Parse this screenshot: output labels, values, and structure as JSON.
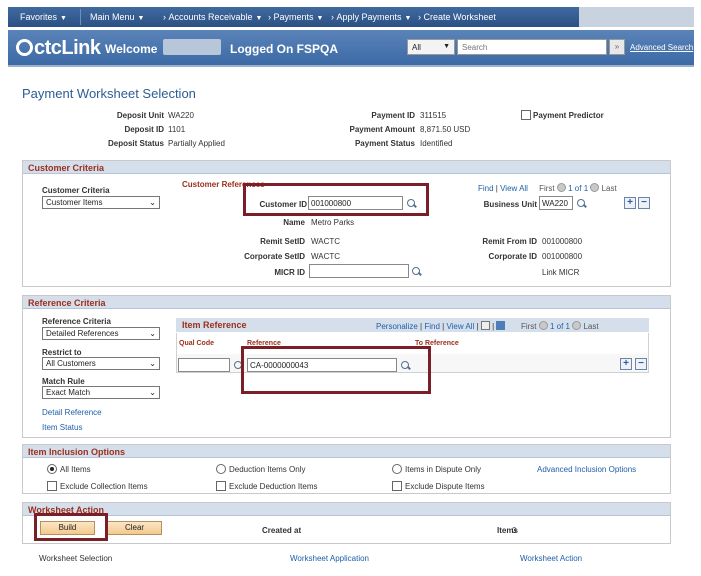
{
  "topnav": {
    "favorites": "Favorites",
    "main_menu": "Main Menu",
    "breadcrumb_accounts_receivable": "Accounts Receivable",
    "breadcrumb_payments": "Payments",
    "breadcrumb_apply_payments": "Apply Payments",
    "breadcrumb_create_worksheet": "Create Worksheet"
  },
  "banner": {
    "logo_text": "ctcLink",
    "welcome": "Welcome",
    "logged_on": "Logged On FSPQA",
    "search_scope": "All",
    "search_placeholder": "Search",
    "advanced_search": "Advanced Search"
  },
  "page_title": "Payment Worksheet Selection",
  "header": {
    "deposit_unit_label": "Deposit Unit",
    "deposit_unit_value": "WA220",
    "deposit_id_label": "Deposit ID",
    "deposit_id_value": "1101",
    "deposit_status_label": "Deposit Status",
    "deposit_status_value": "Partially Applied",
    "payment_id_label": "Payment ID",
    "payment_id_value": "311515",
    "payment_amount_label": "Payment Amount",
    "payment_amount_value": "8,871.50",
    "payment_currency": "USD",
    "payment_status_label": "Payment Status",
    "payment_status_value": "Identified",
    "payment_predictor_label": "Payment Predictor"
  },
  "customer_criteria": {
    "section_title": "Customer Criteria",
    "criteria_label": "Customer Criteria",
    "criteria_value": "Customer Items",
    "references_title": "Customer References",
    "find": "Find",
    "view_all": "View All",
    "first": "First",
    "pager": "1 of 1",
    "last": "Last",
    "customer_id_label": "Customer ID",
    "customer_id_value": "001000800",
    "business_unit_label": "Business Unit",
    "business_unit_value": "WA220",
    "name_label": "Name",
    "name_value": "Metro Parks",
    "remit_setid_label": "Remit SetID",
    "remit_setid_value": "WACTC",
    "remit_from_id_label": "Remit From ID",
    "remit_from_id_value": "001000800",
    "corporate_setid_label": "Corporate SetID",
    "corporate_setid_value": "WACTC",
    "corporate_id_label": "Corporate ID",
    "corporate_id_value": "001000800",
    "micr_id_label": "MICR ID",
    "link_micr": "Link MICR"
  },
  "reference_criteria": {
    "section_title": "Reference Criteria",
    "reference_criteria_label": "Reference Criteria",
    "reference_criteria_value": "Detailed References",
    "restrict_to_label": "Restrict to",
    "restrict_to_value": "All Customers",
    "match_rule_label": "Match Rule",
    "match_rule_value": "Exact Match",
    "detail_reference_link": "Detail Reference",
    "item_status_link": "Item Status",
    "grid_title": "Item Reference",
    "personalize": "Personalize",
    "find": "Find",
    "view_all": "View All",
    "first": "First",
    "pager": "1 of 1",
    "last": "Last",
    "col_qual_code": "Qual Code",
    "col_reference": "Reference",
    "col_to_reference": "To Reference",
    "reference_value": "CA-0000000043"
  },
  "inclusion": {
    "section_title": "Item Inclusion Options",
    "all_items": "All Items",
    "deduction_items_only": "Deduction Items Only",
    "items_in_dispute_only": "Items in Dispute Only",
    "advanced_inclusion_options": "Advanced Inclusion Options",
    "exclude_collection_items": "Exclude Collection Items",
    "exclude_deduction_items": "Exclude Deduction Items",
    "exclude_dispute_items": "Exclude Dispute Items"
  },
  "worksheet_action": {
    "section_title": "Worksheet Action",
    "build": "Build",
    "clear": "Clear",
    "created_at_label": "Created at",
    "items_label": "Items",
    "items_value": "0"
  },
  "footer_tabs": {
    "worksheet_selection": "Worksheet Selection",
    "worksheet_application": "Worksheet Application",
    "worksheet_action": "Worksheet Action"
  },
  "colors": {
    "brand_blue": "#3c6aa5",
    "section_header_text": "#9b2f1b",
    "highlight_box": "#7a1f28",
    "link": "#1f5fa8"
  }
}
